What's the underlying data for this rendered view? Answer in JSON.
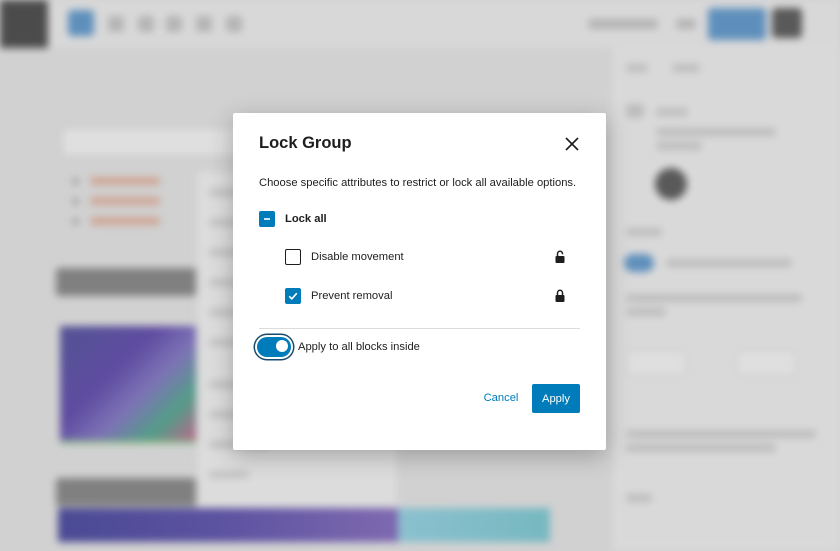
{
  "modal": {
    "title": "Lock Group",
    "description": "Choose specific attributes to restrict or lock all available options.",
    "lock_all": {
      "label": "Lock all",
      "state": "indeterminate"
    },
    "options": [
      {
        "label": "Disable movement",
        "checked": false,
        "lock_icon": "lock-open-icon"
      },
      {
        "label": "Prevent removal",
        "checked": true,
        "lock_icon": "lock-closed-icon"
      }
    ],
    "apply_inside": {
      "label": "Apply to all blocks inside",
      "enabled": true
    },
    "cancel_label": "Cancel",
    "apply_label": "Apply"
  },
  "colors": {
    "accent": "#007cba",
    "text": "#1e1e1e",
    "divider": "#dcdcdc"
  }
}
